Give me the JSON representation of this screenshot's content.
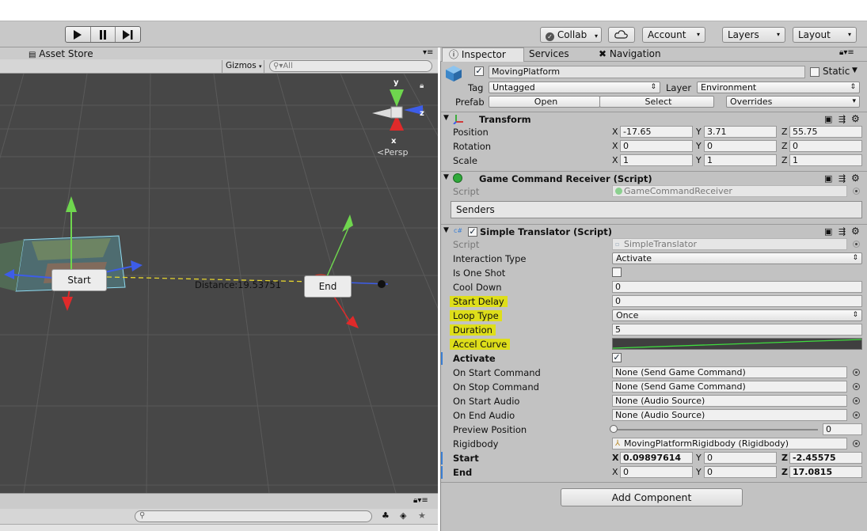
{
  "toolbar": {
    "collab": "Collab",
    "account": "Account",
    "layers": "Layers",
    "layout": "Layout"
  },
  "scene": {
    "tab_label": "Asset Store",
    "gizmos": "Gizmos",
    "search_placeholder": "All",
    "gizmo_axes": {
      "y": "y",
      "z": "z",
      "x": "x"
    },
    "persp": "Persp",
    "start_label": "Start",
    "end_label": "End",
    "distance_label": "Distance:19.53751"
  },
  "inspector_tabs": [
    "Inspector",
    "Services",
    "Navigation"
  ],
  "object": {
    "name": "MovingPlatform",
    "static_label": "Static",
    "tag_label": "Tag",
    "tag_value": "Untagged",
    "layer_label": "Layer",
    "layer_value": "Environment",
    "prefab_label": "Prefab",
    "prefab_open": "Open",
    "prefab_select": "Select",
    "prefab_overrides": "Overrides"
  },
  "transform": {
    "title": "Transform",
    "rows": [
      {
        "label": "Position",
        "x": "-17.65",
        "y": "3.71",
        "z": "55.75"
      },
      {
        "label": "Rotation",
        "x": "0",
        "y": "0",
        "z": "0"
      },
      {
        "label": "Scale",
        "x": "1",
        "y": "1",
        "z": "1"
      }
    ]
  },
  "receiver": {
    "title": "Game Command Receiver (Script)",
    "script_label": "Script",
    "script_value": "GameCommandReceiver",
    "senders": "Senders"
  },
  "translator": {
    "title": "Simple Translator (Script)",
    "script_label": "Script",
    "script_value": "SimpleTranslator",
    "interaction_type_label": "Interaction Type",
    "interaction_type_value": "Activate",
    "is_one_shot_label": "Is One Shot",
    "cool_down_label": "Cool Down",
    "cool_down_value": "0",
    "start_delay_label": "Start Delay",
    "start_delay_value": "0",
    "loop_type_label": "Loop Type",
    "loop_type_value": "Once",
    "duration_label": "Duration",
    "duration_value": "5",
    "accel_curve_label": "Accel Curve",
    "activate_label": "Activate",
    "on_start_command_label": "On Start Command",
    "on_start_command_value": "None (Send Game Command)",
    "on_stop_command_label": "On Stop Command",
    "on_stop_command_value": "None (Send Game Command)",
    "on_start_audio_label": "On Start Audio",
    "on_start_audio_value": "None (Audio Source)",
    "on_end_audio_label": "On End Audio",
    "on_end_audio_value": "None (Audio Source)",
    "preview_position_label": "Preview Position",
    "preview_position_value": "0",
    "rigidbody_label": "Rigidbody",
    "rigidbody_value": "MovingPlatformRigidbody (Rigidbody)",
    "start_label": "Start",
    "start": {
      "x": "0.09897614",
      "y": "0",
      "z": "-2.45575"
    },
    "end_label": "End",
    "end": {
      "x": "0",
      "y": "0",
      "z": "17.0815"
    }
  },
  "add_component": "Add Component",
  "colors": {
    "highlight": "#dede1a",
    "scene_bg": "#474747",
    "panel_bg": "#c2c2c2",
    "accent_blue": "#3b7fd4"
  }
}
